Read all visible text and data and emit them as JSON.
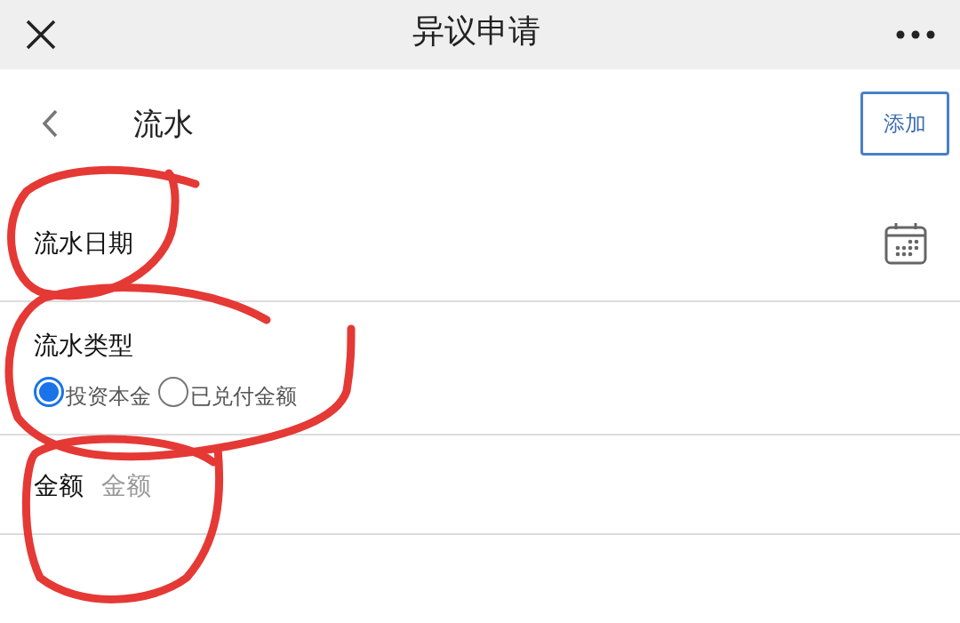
{
  "top_bar": {
    "title": "异议申请"
  },
  "header": {
    "title": "流水",
    "action": "添加"
  },
  "fields": [
    {
      "kind": "date",
      "label": "流水日期"
    },
    {
      "kind": "radio",
      "label": "流水类型",
      "options": [
        {
          "label": "投资本金",
          "selected": true
        },
        {
          "label": "已兑付金额",
          "selected": false
        }
      ]
    },
    {
      "kind": "input",
      "label": "金额",
      "placeholder": "金额"
    }
  ]
}
